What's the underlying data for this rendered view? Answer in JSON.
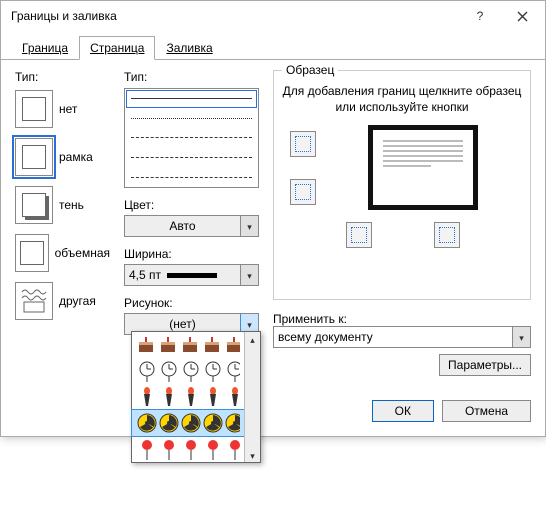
{
  "window": {
    "title": "Границы и заливка"
  },
  "tabs": {
    "border": "Граница",
    "page": "Страница",
    "fill": "Заливка",
    "active": "page"
  },
  "left": {
    "label": "Тип:",
    "items": [
      {
        "key": "none",
        "label": "нет"
      },
      {
        "key": "box",
        "label": "рамка"
      },
      {
        "key": "shadow",
        "label": "тень"
      },
      {
        "key": "threeD",
        "label": "объемная"
      },
      {
        "key": "custom",
        "label": "другая"
      }
    ],
    "selected": "box"
  },
  "mid": {
    "type_label": "Тип:",
    "color_label": "Цвет:",
    "color_value": "Авто",
    "width_label": "Ширина:",
    "width_value": "4,5 пт",
    "art_label": "Рисунок:",
    "art_value": "(нет)"
  },
  "art_dropdown": {
    "rows": [
      "pattern-cakes",
      "pattern-clocks",
      "pattern-torches",
      "pattern-radiation",
      "pattern-lollipops"
    ],
    "selected_index": 3
  },
  "sample": {
    "legend": "Образец",
    "message": "Для добавления границ щелкните образец или используйте кнопки"
  },
  "apply": {
    "label": "Применить к:",
    "value": "всему документу",
    "params": "Параметры..."
  },
  "footer": {
    "ok": "ОК",
    "cancel": "Отмена"
  }
}
